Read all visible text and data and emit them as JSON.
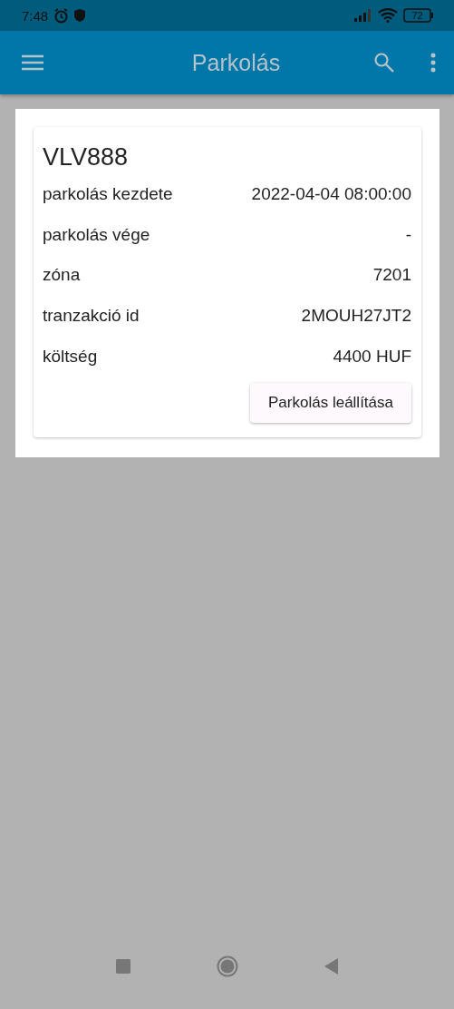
{
  "status_bar": {
    "time": "7:48",
    "battery": "72"
  },
  "app_bar": {
    "title": "Parkolás"
  },
  "card": {
    "plate": "VLV888",
    "rows": [
      {
        "label": "parkolás kezdete",
        "value": "2022-04-04 08:00:00"
      },
      {
        "label": "parkolás vége",
        "value": "-"
      },
      {
        "label": "zóna",
        "value": "7201"
      },
      {
        "label": "tranzakció id",
        "value": "2MOUH27JT2"
      },
      {
        "label": "költség",
        "value": "4400 HUF"
      }
    ],
    "button": "Parkolás leállítása"
  }
}
